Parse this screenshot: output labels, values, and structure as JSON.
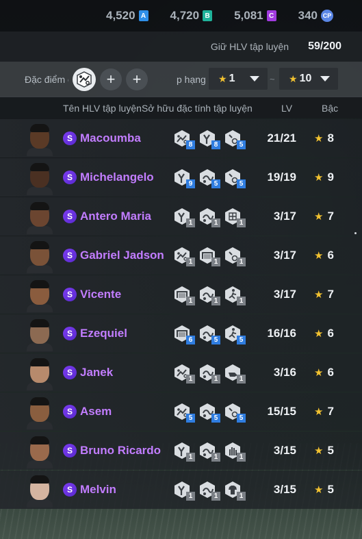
{
  "currencies": [
    {
      "value": "4,520",
      "badge": "A",
      "color": "#2f8fe8"
    },
    {
      "value": "4,720",
      "badge": "B",
      "color": "#1fb39b"
    },
    {
      "value": "5,081",
      "badge": "C",
      "color": "#a23be0"
    },
    {
      "value": "340",
      "badge": "CP",
      "color": "#5a86e6",
      "round": true
    }
  ],
  "coach_count": {
    "label": "Giữ HLV tập luyện",
    "value": "59/200"
  },
  "filter": {
    "trait_label": "Đặc điểm c",
    "selected_trait_icon": "tactics-trait-icon",
    "rank_label": "p hạng",
    "rank_from": "1",
    "rank_to": "10",
    "separator": "~"
  },
  "header": {
    "name": "Tên HLV tập luyện",
    "traits": "Sở hữu đặc tính tập luyện",
    "lv": "LV",
    "grade": "Bậc"
  },
  "coaches": [
    {
      "badge": "S",
      "name": "Macoumba",
      "lv": "21/21",
      "grade": "8",
      "skin": "#5a3a26",
      "traits": [
        {
          "icon": "tactics-trait-icon",
          "level": "8",
          "color": "#2f7de0"
        },
        {
          "icon": "strength-trait-icon",
          "level": "8",
          "color": "#2f7de0"
        },
        {
          "icon": "ball-trait-icon",
          "level": "5",
          "color": "#2f7de0"
        }
      ]
    },
    {
      "badge": "S",
      "name": "Michelangelo",
      "lv": "19/19",
      "grade": "9",
      "skin": "#4a3022",
      "traits": [
        {
          "icon": "strength-trait-icon",
          "level": "9",
          "color": "#2f7de0"
        },
        {
          "icon": "dribble-trait-icon",
          "level": "5",
          "color": "#2f7de0"
        },
        {
          "icon": "ball-trait-icon",
          "level": "5",
          "color": "#2f7de0"
        }
      ]
    },
    {
      "badge": "S",
      "name": "Antero Maria",
      "lv": "3/17",
      "grade": "7",
      "skin": "#6b4530",
      "traits": [
        {
          "icon": "strength-trait-icon",
          "level": "1",
          "color": "#7b8086"
        },
        {
          "icon": "dribble-trait-icon",
          "level": "1",
          "color": "#7b8086"
        },
        {
          "icon": "grid-trait-icon",
          "level": "1",
          "color": "#7b8086"
        }
      ]
    },
    {
      "badge": "S",
      "name": "Gabriel Jadson",
      "lv": "3/17",
      "grade": "6",
      "skin": "#7a5238",
      "traits": [
        {
          "icon": "tactics-trait-icon",
          "level": "1",
          "color": "#7b8086"
        },
        {
          "icon": "goal-trait-icon",
          "level": "1",
          "color": "#7b8086"
        },
        {
          "icon": "ball-trait-icon",
          "level": "1",
          "color": "#7b8086"
        }
      ]
    },
    {
      "badge": "S",
      "name": "Vicente",
      "lv": "3/17",
      "grade": "7",
      "skin": "#8a5c3e",
      "traits": [
        {
          "icon": "goal-trait-icon",
          "level": "1",
          "color": "#7b8086"
        },
        {
          "icon": "dribble-trait-icon",
          "level": "1",
          "color": "#7b8086"
        },
        {
          "icon": "runner-trait-icon",
          "level": "1",
          "color": "#7b8086"
        }
      ]
    },
    {
      "badge": "S",
      "name": "Ezequiel",
      "lv": "16/16",
      "grade": "6",
      "skin": "#8c6a52",
      "traits": [
        {
          "icon": "goal-trait-icon",
          "level": "6",
          "color": "#2f7de0"
        },
        {
          "icon": "dribble-trait-icon",
          "level": "5",
          "color": "#2f7de0"
        },
        {
          "icon": "runner-trait-icon",
          "level": "5",
          "color": "#2f7de0"
        }
      ]
    },
    {
      "badge": "S",
      "name": "Janek",
      "lv": "3/16",
      "grade": "6",
      "skin": "#b78a6c",
      "traits": [
        {
          "icon": "tactics-trait-icon",
          "level": "1",
          "color": "#7b8086"
        },
        {
          "icon": "dribble-trait-icon",
          "level": "1",
          "color": "#7b8086"
        },
        {
          "icon": "whistle-trait-icon",
          "level": "1",
          "color": "#7b8086"
        }
      ]
    },
    {
      "badge": "S",
      "name": "Asem",
      "lv": "15/15",
      "grade": "7",
      "skin": "#8a5e3f",
      "traits": [
        {
          "icon": "tactics-trait-icon",
          "level": "5",
          "color": "#2f7de0"
        },
        {
          "icon": "dribble-trait-icon",
          "level": "5",
          "color": "#2f7de0"
        },
        {
          "icon": "ball-trait-icon",
          "level": "5",
          "color": "#2f7de0"
        }
      ]
    },
    {
      "badge": "S",
      "name": "Bruno Ricardo",
      "lv": "3/15",
      "grade": "5",
      "skin": "#9a6a4c",
      "traits": [
        {
          "icon": "strength-trait-icon",
          "level": "1",
          "color": "#7b8086"
        },
        {
          "icon": "dribble-trait-icon",
          "level": "1",
          "color": "#7b8086"
        },
        {
          "icon": "hand-trait-icon",
          "level": "1",
          "color": "#7b8086"
        }
      ]
    },
    {
      "badge": "S",
      "name": "Melvin",
      "lv": "3/15",
      "grade": "5",
      "skin": "#d4b4a0",
      "traits": [
        {
          "icon": "strength-trait-icon",
          "level": "1",
          "color": "#7b8086"
        },
        {
          "icon": "dribble-trait-icon",
          "level": "1",
          "color": "#7b8086"
        },
        {
          "icon": "shirt-trait-icon",
          "level": "1",
          "color": "#7b8086"
        }
      ]
    }
  ]
}
